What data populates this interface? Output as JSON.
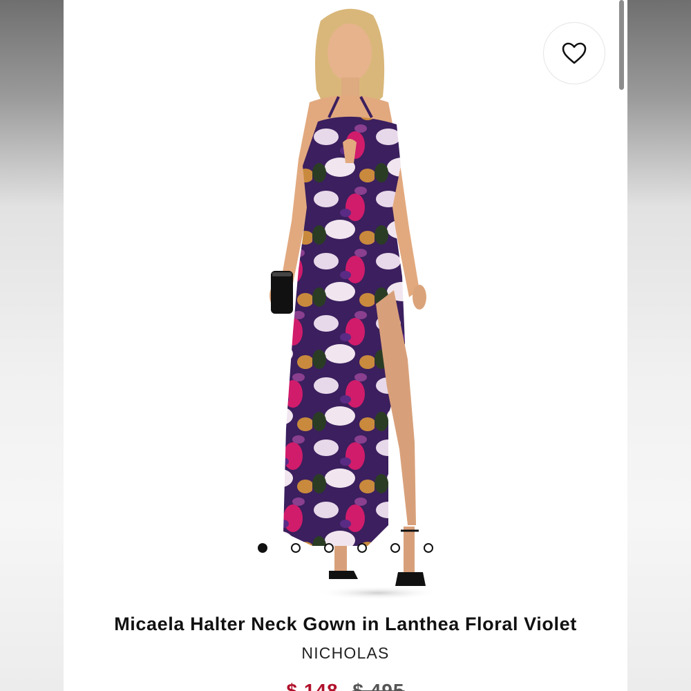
{
  "product": {
    "title": "Micaela Halter Neck Gown in Lanthea Floral Violet",
    "brand": "NICHOLAS",
    "sale_price": "$ 148",
    "original_price": "$ 495",
    "image": "model-in-floral-halter-gown",
    "gallery_count": 6,
    "gallery_active_index": 0
  },
  "icons": {
    "wishlist": "heart-outline-icon"
  },
  "colors": {
    "background": "#ffffff",
    "side_bars": "#d9d9d9",
    "text": "#111111",
    "sale_price": "#b0102a",
    "dress_base": "#3b1f5e",
    "dress_pink": "#d11c6b",
    "dress_lavender": "#e8d9ea"
  }
}
